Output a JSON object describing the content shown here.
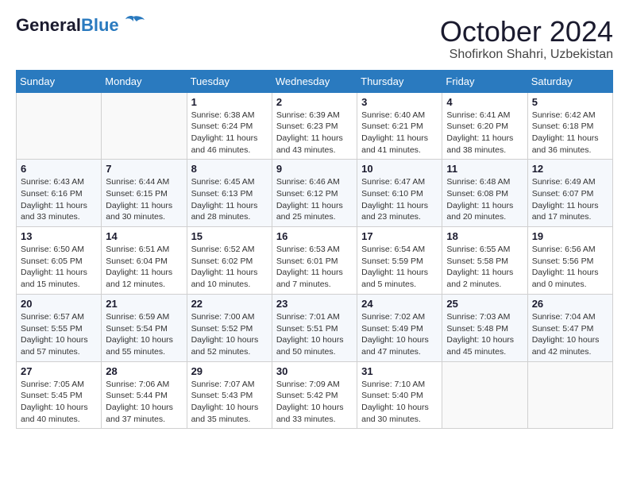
{
  "header": {
    "logo_line1": "General",
    "logo_line2": "Blue",
    "month_title": "October 2024",
    "location": "Shofirkon Shahri, Uzbekistan"
  },
  "weekdays": [
    "Sunday",
    "Monday",
    "Tuesday",
    "Wednesday",
    "Thursday",
    "Friday",
    "Saturday"
  ],
  "weeks": [
    [
      {
        "day": "",
        "info": ""
      },
      {
        "day": "",
        "info": ""
      },
      {
        "day": "1",
        "info": "Sunrise: 6:38 AM\nSunset: 6:24 PM\nDaylight: 11 hours and 46 minutes."
      },
      {
        "day": "2",
        "info": "Sunrise: 6:39 AM\nSunset: 6:23 PM\nDaylight: 11 hours and 43 minutes."
      },
      {
        "day": "3",
        "info": "Sunrise: 6:40 AM\nSunset: 6:21 PM\nDaylight: 11 hours and 41 minutes."
      },
      {
        "day": "4",
        "info": "Sunrise: 6:41 AM\nSunset: 6:20 PM\nDaylight: 11 hours and 38 minutes."
      },
      {
        "day": "5",
        "info": "Sunrise: 6:42 AM\nSunset: 6:18 PM\nDaylight: 11 hours and 36 minutes."
      }
    ],
    [
      {
        "day": "6",
        "info": "Sunrise: 6:43 AM\nSunset: 6:16 PM\nDaylight: 11 hours and 33 minutes."
      },
      {
        "day": "7",
        "info": "Sunrise: 6:44 AM\nSunset: 6:15 PM\nDaylight: 11 hours and 30 minutes."
      },
      {
        "day": "8",
        "info": "Sunrise: 6:45 AM\nSunset: 6:13 PM\nDaylight: 11 hours and 28 minutes."
      },
      {
        "day": "9",
        "info": "Sunrise: 6:46 AM\nSunset: 6:12 PM\nDaylight: 11 hours and 25 minutes."
      },
      {
        "day": "10",
        "info": "Sunrise: 6:47 AM\nSunset: 6:10 PM\nDaylight: 11 hours and 23 minutes."
      },
      {
        "day": "11",
        "info": "Sunrise: 6:48 AM\nSunset: 6:08 PM\nDaylight: 11 hours and 20 minutes."
      },
      {
        "day": "12",
        "info": "Sunrise: 6:49 AM\nSunset: 6:07 PM\nDaylight: 11 hours and 17 minutes."
      }
    ],
    [
      {
        "day": "13",
        "info": "Sunrise: 6:50 AM\nSunset: 6:05 PM\nDaylight: 11 hours and 15 minutes."
      },
      {
        "day": "14",
        "info": "Sunrise: 6:51 AM\nSunset: 6:04 PM\nDaylight: 11 hours and 12 minutes."
      },
      {
        "day": "15",
        "info": "Sunrise: 6:52 AM\nSunset: 6:02 PM\nDaylight: 11 hours and 10 minutes."
      },
      {
        "day": "16",
        "info": "Sunrise: 6:53 AM\nSunset: 6:01 PM\nDaylight: 11 hours and 7 minutes."
      },
      {
        "day": "17",
        "info": "Sunrise: 6:54 AM\nSunset: 5:59 PM\nDaylight: 11 hours and 5 minutes."
      },
      {
        "day": "18",
        "info": "Sunrise: 6:55 AM\nSunset: 5:58 PM\nDaylight: 11 hours and 2 minutes."
      },
      {
        "day": "19",
        "info": "Sunrise: 6:56 AM\nSunset: 5:56 PM\nDaylight: 11 hours and 0 minutes."
      }
    ],
    [
      {
        "day": "20",
        "info": "Sunrise: 6:57 AM\nSunset: 5:55 PM\nDaylight: 10 hours and 57 minutes."
      },
      {
        "day": "21",
        "info": "Sunrise: 6:59 AM\nSunset: 5:54 PM\nDaylight: 10 hours and 55 minutes."
      },
      {
        "day": "22",
        "info": "Sunrise: 7:00 AM\nSunset: 5:52 PM\nDaylight: 10 hours and 52 minutes."
      },
      {
        "day": "23",
        "info": "Sunrise: 7:01 AM\nSunset: 5:51 PM\nDaylight: 10 hours and 50 minutes."
      },
      {
        "day": "24",
        "info": "Sunrise: 7:02 AM\nSunset: 5:49 PM\nDaylight: 10 hours and 47 minutes."
      },
      {
        "day": "25",
        "info": "Sunrise: 7:03 AM\nSunset: 5:48 PM\nDaylight: 10 hours and 45 minutes."
      },
      {
        "day": "26",
        "info": "Sunrise: 7:04 AM\nSunset: 5:47 PM\nDaylight: 10 hours and 42 minutes."
      }
    ],
    [
      {
        "day": "27",
        "info": "Sunrise: 7:05 AM\nSunset: 5:45 PM\nDaylight: 10 hours and 40 minutes."
      },
      {
        "day": "28",
        "info": "Sunrise: 7:06 AM\nSunset: 5:44 PM\nDaylight: 10 hours and 37 minutes."
      },
      {
        "day": "29",
        "info": "Sunrise: 7:07 AM\nSunset: 5:43 PM\nDaylight: 10 hours and 35 minutes."
      },
      {
        "day": "30",
        "info": "Sunrise: 7:09 AM\nSunset: 5:42 PM\nDaylight: 10 hours and 33 minutes."
      },
      {
        "day": "31",
        "info": "Sunrise: 7:10 AM\nSunset: 5:40 PM\nDaylight: 10 hours and 30 minutes."
      },
      {
        "day": "",
        "info": ""
      },
      {
        "day": "",
        "info": ""
      }
    ]
  ]
}
